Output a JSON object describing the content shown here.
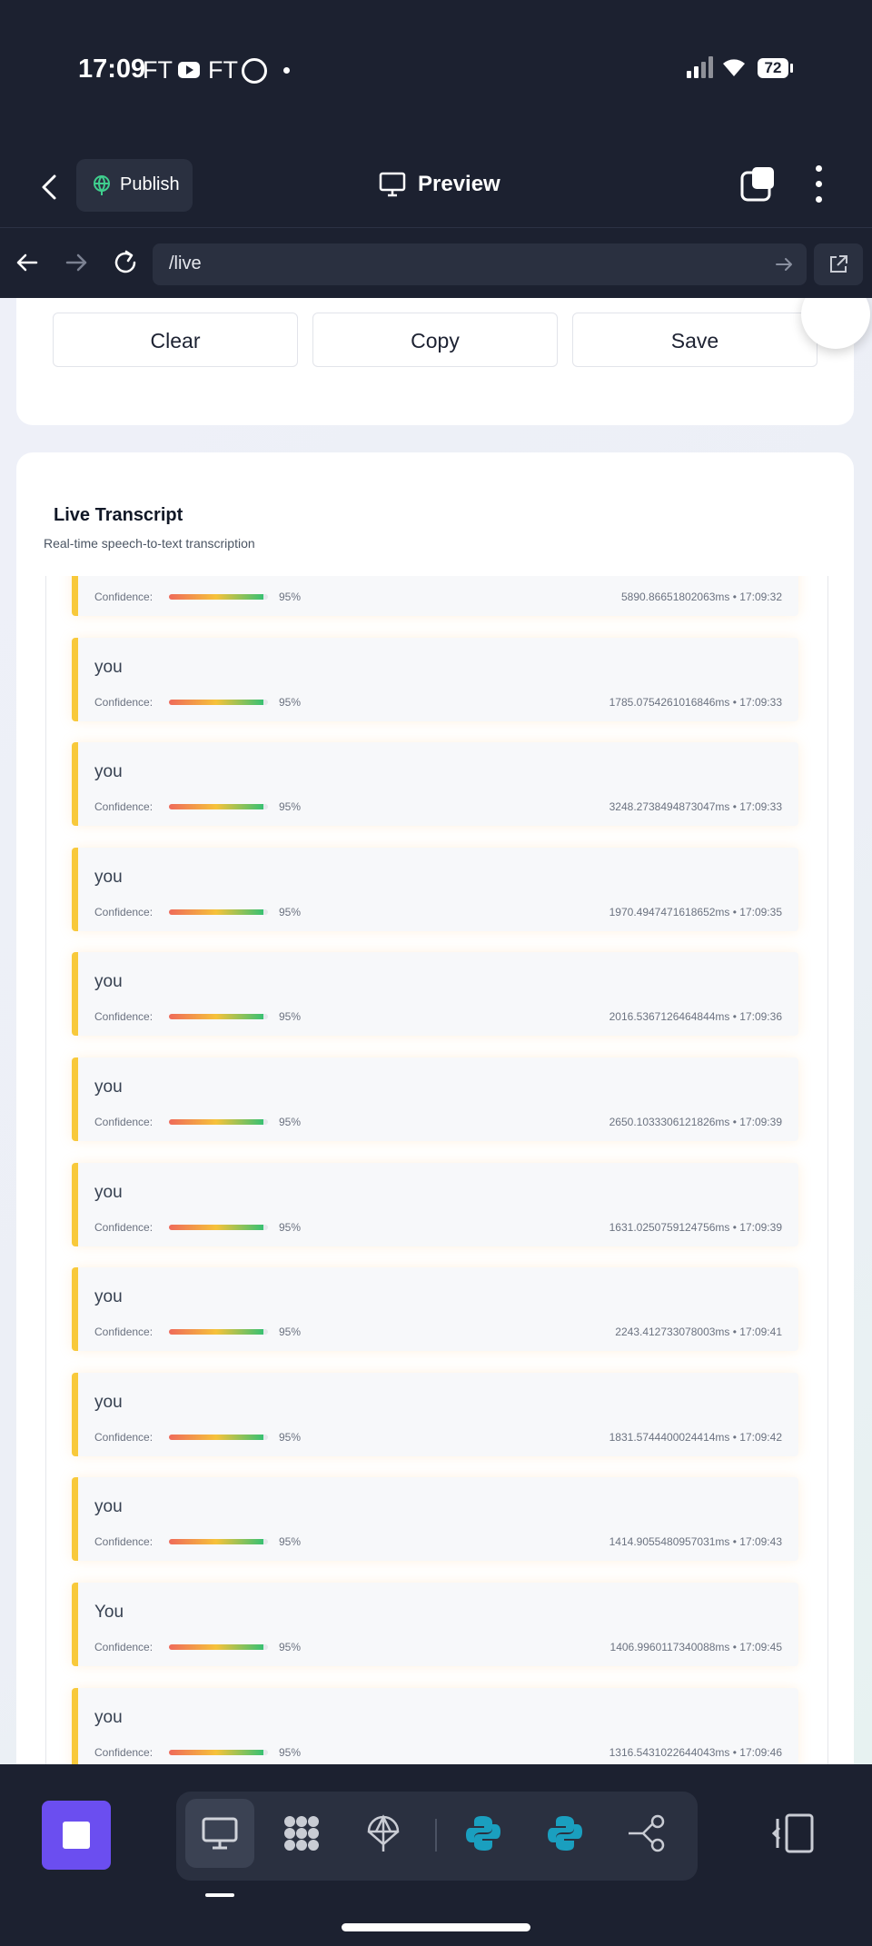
{
  "status_bar": {
    "time": "17:09",
    "app1": "FT",
    "app2": "FT",
    "battery": "72"
  },
  "header": {
    "publish_label": "Publish",
    "preview_label": "Preview"
  },
  "browser": {
    "url": "/live"
  },
  "actions": {
    "clear": "Clear",
    "copy": "Copy",
    "save": "Save"
  },
  "transcript": {
    "title": "Live Transcript",
    "subtitle": "Real-time speech-to-text transcription",
    "confidence_label": "Confidence:",
    "confidence_value": 0.95,
    "entries": [
      {
        "text": "",
        "pct": "95%",
        "meta": "5890.86651802063ms • 17:09:32"
      },
      {
        "text": "you",
        "pct": "95%",
        "meta": "1785.0754261016846ms • 17:09:33"
      },
      {
        "text": "you",
        "pct": "95%",
        "meta": "3248.2738494873047ms • 17:09:33"
      },
      {
        "text": "you",
        "pct": "95%",
        "meta": "1970.4947471618652ms • 17:09:35"
      },
      {
        "text": "you",
        "pct": "95%",
        "meta": "2016.5367126464844ms • 17:09:36"
      },
      {
        "text": "you",
        "pct": "95%",
        "meta": "2650.1033306121826ms • 17:09:39"
      },
      {
        "text": "you",
        "pct": "95%",
        "meta": "1631.0250759124756ms • 17:09:39"
      },
      {
        "text": "you",
        "pct": "95%",
        "meta": "2243.412733078003ms • 17:09:41"
      },
      {
        "text": "you",
        "pct": "95%",
        "meta": "1831.5744400024414ms • 17:09:42"
      },
      {
        "text": "you",
        "pct": "95%",
        "meta": "1414.9055480957031ms • 17:09:43"
      },
      {
        "text": "You",
        "pct": "95%",
        "meta": "1406.9960117340088ms • 17:09:45"
      },
      {
        "text": "you",
        "pct": "95%",
        "meta": "1316.5431022644043ms • 17:09:46"
      }
    ]
  },
  "colors": {
    "accent_purple": "#6b4ef0",
    "entry_border": "#f8c93b",
    "python_blue": "#1a9fbf",
    "dark_bg": "#1c2130"
  },
  "dock": {
    "items": [
      "desktop-icon",
      "grid-blob-icon",
      "antenna-icon",
      "python-icon",
      "python-icon",
      "share-nodes-icon"
    ]
  }
}
